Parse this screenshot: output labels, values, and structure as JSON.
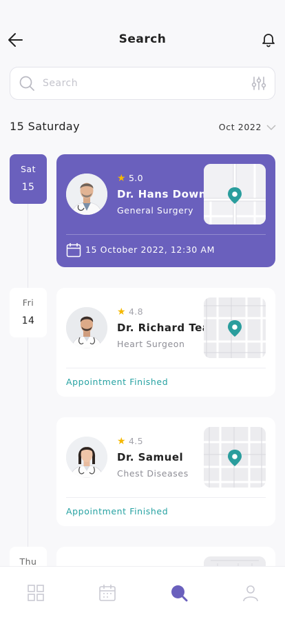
{
  "header": {
    "title": "Search"
  },
  "search": {
    "placeholder": "Search",
    "value": ""
  },
  "date_bar": {
    "day_label": "15 Saturday",
    "month_label": "Oct 2022"
  },
  "days": [
    {
      "weekday": "Sat",
      "date": "15",
      "active": true
    },
    {
      "weekday": "Fri",
      "date": "14",
      "active": false
    },
    {
      "weekday": "Thu",
      "date": "",
      "active": false
    }
  ],
  "appointments": [
    {
      "rating": "5.0",
      "doctor": "Dr. Hans Down",
      "specialty": "General Surgery",
      "datetime": "15 October 2022, 12:30 AM",
      "status": "",
      "active": true
    },
    {
      "rating": "4.8",
      "doctor": "Dr. Richard Tea",
      "specialty": "Heart Surgeon",
      "datetime": "",
      "status": "Appointment Finished",
      "active": false
    },
    {
      "rating": "4.5",
      "doctor": "Dr. Samuel",
      "specialty": "Chest Diseases",
      "datetime": "",
      "status": "Appointment Finished",
      "active": false
    }
  ],
  "tabs": [
    {
      "icon": "grid-icon",
      "active": false
    },
    {
      "icon": "calendar-icon",
      "active": false
    },
    {
      "icon": "search-icon",
      "active": true
    },
    {
      "icon": "profile-icon",
      "active": false
    }
  ],
  "colors": {
    "accent": "#6a60bd",
    "status": "#26a2a2",
    "star": "#f5b800",
    "pin": "#2a9d9d"
  }
}
